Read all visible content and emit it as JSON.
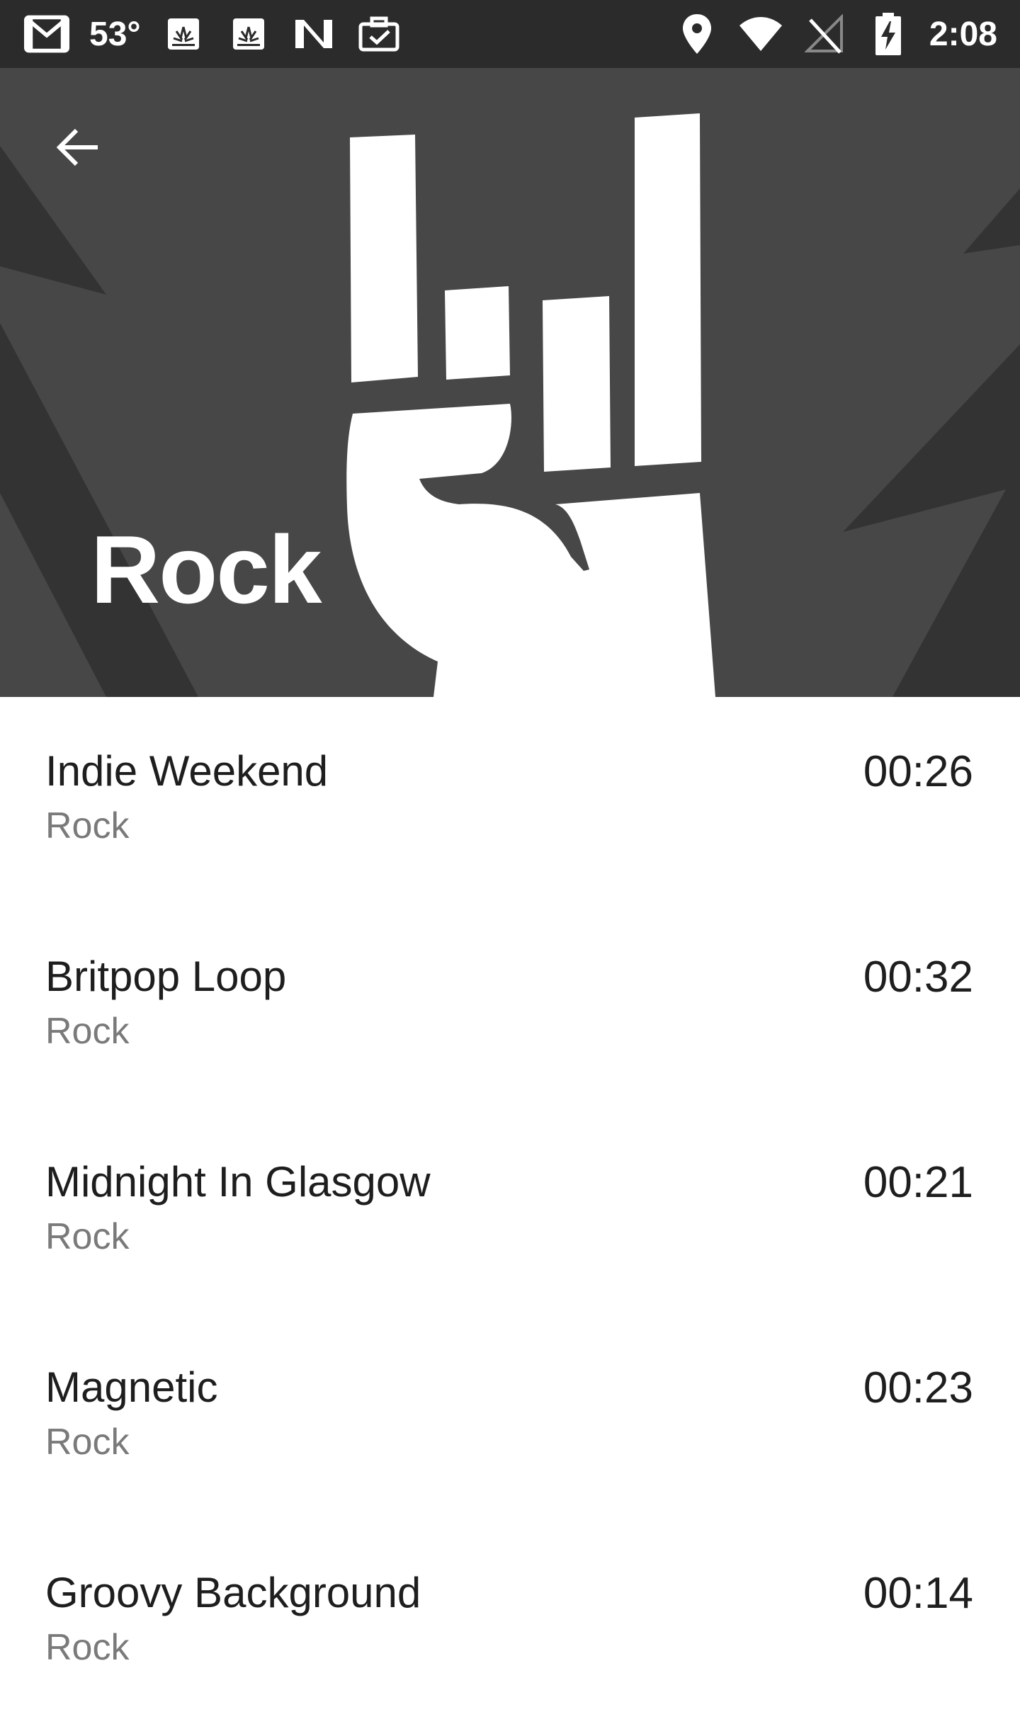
{
  "status_bar": {
    "temperature": "53°",
    "time": "2:08",
    "left_icons": [
      "gmail-icon",
      "temperature-text",
      "huawei-icon",
      "huawei-icon",
      "n-logo-icon",
      "briefcase-check-icon"
    ],
    "right_icons": [
      "location-icon",
      "wifi-icon",
      "no-signal-icon",
      "battery-charging-icon"
    ]
  },
  "header": {
    "back_icon": "arrow-back-icon",
    "title": "Rock",
    "hero_icon": "rock-hand-icon"
  },
  "tracks": [
    {
      "title": "Indie Weekend",
      "genre": "Rock",
      "duration": "00:26"
    },
    {
      "title": "Britpop Loop",
      "genre": "Rock",
      "duration": "00:32"
    },
    {
      "title": "Midnight In Glasgow",
      "genre": "Rock",
      "duration": "00:21"
    },
    {
      "title": "Magnetic",
      "genre": "Rock",
      "duration": "00:23"
    },
    {
      "title": "Groovy Background",
      "genre": "Rock",
      "duration": "00:14"
    }
  ],
  "colors": {
    "status_bar": "#2b2b2b",
    "hero_bg": "#474747",
    "hero_rays": "#333333",
    "title_text": "#1e1e1e",
    "subtitle_text": "#7a7a7a"
  }
}
